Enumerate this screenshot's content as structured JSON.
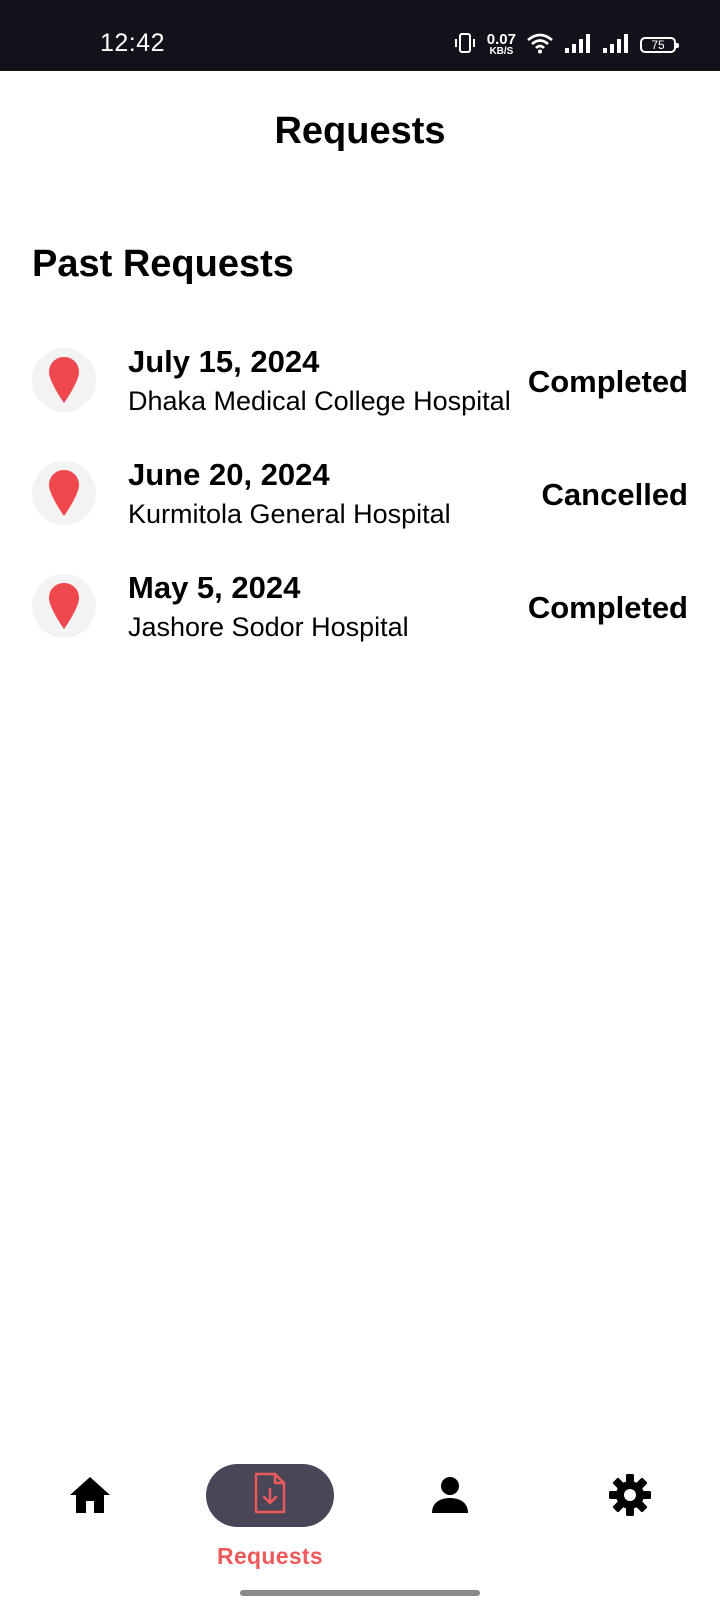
{
  "status_bar": {
    "time": "12:42",
    "net_speed_value": "0.07",
    "net_speed_unit": "KB/S",
    "battery": "75"
  },
  "header": {
    "title": "Requests"
  },
  "section": {
    "title": "Past Requests"
  },
  "requests": [
    {
      "date": "July 15, 2024",
      "hospital": "Dhaka Medical College Hospital",
      "status": "Completed"
    },
    {
      "date": "June 20, 2024",
      "hospital": "Kurmitola General Hospital",
      "status": "Cancelled"
    },
    {
      "date": "May 5, 2024",
      "hospital": "Jashore Sodor Hospital",
      "status": "Completed"
    }
  ],
  "bottom_nav": {
    "items": [
      {
        "icon": "home-icon",
        "active": false
      },
      {
        "icon": "document-download-icon",
        "label": "Requests",
        "active": true
      },
      {
        "icon": "person-icon",
        "active": false
      },
      {
        "icon": "gear-icon",
        "active": false
      }
    ]
  },
  "colors": {
    "accent": "#ec5b5b",
    "pin": "#f0484f",
    "status_bar_bg": "#13121b",
    "active_pill": "#4a4658"
  }
}
